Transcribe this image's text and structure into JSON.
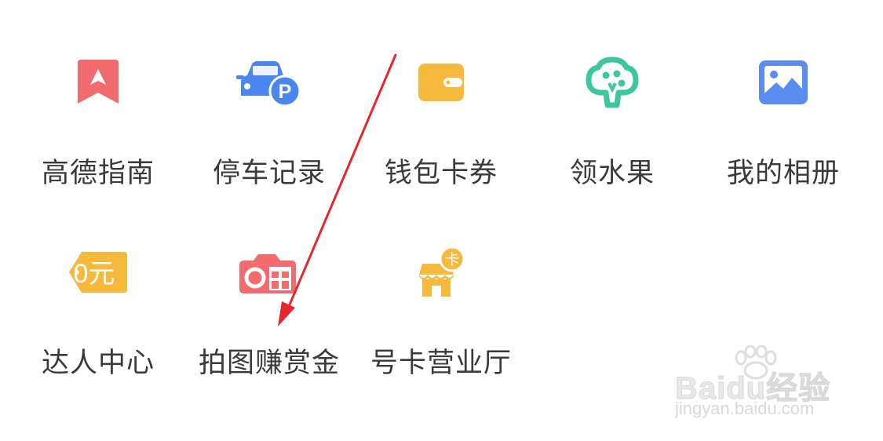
{
  "grid": {
    "items": [
      {
        "label": "高德指南",
        "icon": "bookmark-arrow-icon",
        "color": "#f26b6e"
      },
      {
        "label": "停车记录",
        "icon": "car-parking-icon",
        "color": "#4a86f0"
      },
      {
        "label": "钱包卡券",
        "icon": "wallet-icon",
        "color": "#f6b93b"
      },
      {
        "label": "领水果",
        "icon": "fruit-tree-icon",
        "color": "#3dc7a0"
      },
      {
        "label": "我的相册",
        "icon": "photo-album-icon",
        "color": "#5b8cf2"
      },
      {
        "label": "达人中心",
        "icon": "price-tag-icon",
        "color": "#f6b93b",
        "badge": "0元"
      },
      {
        "label": "拍图赚赏金",
        "icon": "camera-gift-icon",
        "color": "#f26b6e"
      },
      {
        "label": "号卡营业厅",
        "icon": "shop-card-icon",
        "color": "#f6b93b",
        "badge": "卡"
      }
    ]
  },
  "annotation": {
    "arrow_color": "#e8262b"
  },
  "watermark": {
    "logo": "Baidu经验",
    "url": "jingyan.baidu.com"
  }
}
